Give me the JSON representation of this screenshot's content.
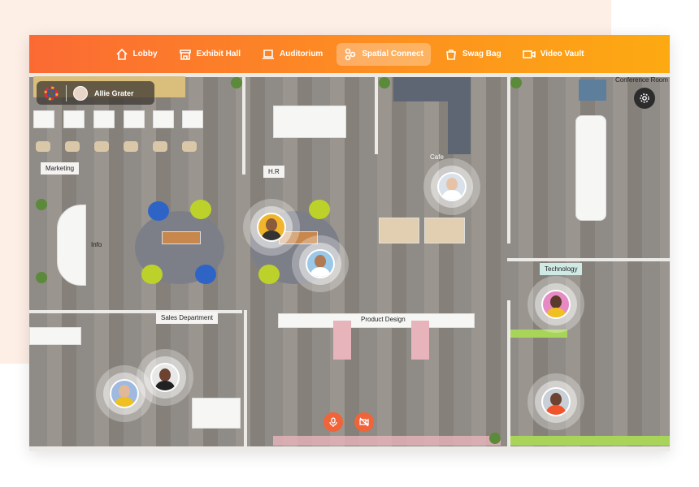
{
  "nav": {
    "items": [
      {
        "label": "Lobby",
        "icon": "home-icon"
      },
      {
        "label": "Exhibit Hall",
        "icon": "store-icon"
      },
      {
        "label": "Auditorium",
        "icon": "laptop-icon"
      },
      {
        "label": "Spatial Connect",
        "icon": "people-icon",
        "active": true
      },
      {
        "label": "Swag Bag",
        "icon": "bag-icon"
      },
      {
        "label": "Video Vault",
        "icon": "video-icon"
      }
    ]
  },
  "user": {
    "name": "Allie Grater"
  },
  "rooms": {
    "marketing": "Marketing",
    "hr": "H.R",
    "cafe": "Cafe",
    "conference": "Conference Room",
    "info": "Info",
    "technology": "Technology",
    "sales": "Sales Department",
    "product": "Product Design"
  },
  "colors": {
    "accent_start": "#fb6a33",
    "accent_end": "#fdaa12",
    "control": "#f0643a"
  }
}
